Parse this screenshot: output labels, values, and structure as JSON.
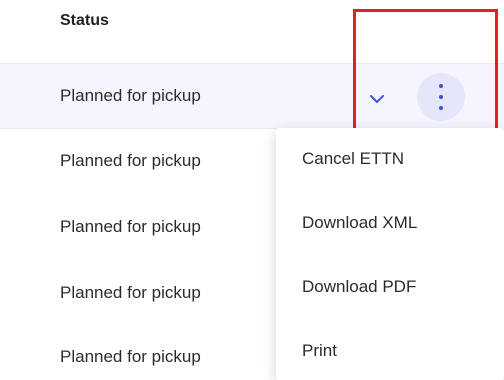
{
  "table": {
    "header": "Status",
    "rows": [
      {
        "status": "Planned for pickup"
      },
      {
        "status": "Planned for pickup"
      },
      {
        "status": "Planned for pickup"
      },
      {
        "status": "Planned for pickup"
      },
      {
        "status": "Planned for pickup"
      }
    ]
  },
  "menu": {
    "items": [
      {
        "label": "Cancel ETTN"
      },
      {
        "label": "Download XML"
      },
      {
        "label": "Download PDF"
      },
      {
        "label": "Print"
      }
    ]
  },
  "colors": {
    "accent": "#3f51d8",
    "kebab_bg": "#e5e6fb",
    "selected_row_bg": "#f5f5ff",
    "highlight_border": "#e41f26"
  },
  "icons": {
    "expand": "chevron-down-icon",
    "more": "more-vertical-icon"
  }
}
